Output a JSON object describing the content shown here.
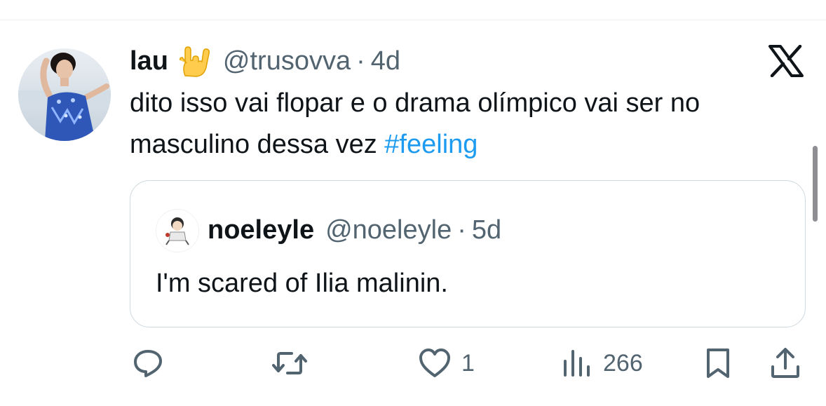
{
  "tweet": {
    "author": {
      "display_name": "lau",
      "emoji_icon": "love-you-gesture-icon",
      "handle": "@trusovva",
      "separator": "·",
      "time": "4d"
    },
    "text_plain": "dito isso vai flopar e o drama olímpico vai ser no masculino dessa vez ",
    "hashtag": "#feeling",
    "brand_icon": "x-logo-icon"
  },
  "quote": {
    "author": {
      "display_name": "noeleyle",
      "handle": "@noeleyle",
      "separator": "·",
      "time": "5d"
    },
    "text": "I'm scared of Ilia malinin."
  },
  "actions": {
    "reply": {
      "icon": "reply-icon",
      "count": ""
    },
    "repost": {
      "icon": "repost-icon",
      "count": ""
    },
    "like": {
      "icon": "heart-icon",
      "count": "1"
    },
    "views": {
      "icon": "views-icon",
      "count": "266"
    },
    "bookmark": {
      "icon": "bookmark-icon"
    },
    "share": {
      "icon": "share-icon"
    }
  },
  "colors": {
    "text": "#0f1419",
    "secondary": "#536471",
    "link": "#1d9bf0",
    "border": "#cfd9de"
  }
}
